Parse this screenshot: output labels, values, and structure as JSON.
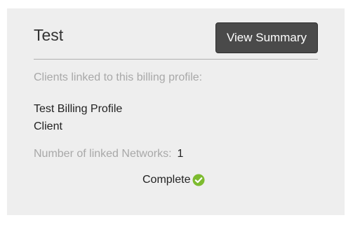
{
  "card": {
    "title": "Test",
    "view_summary_label": "View Summary",
    "clients_label": "Clients linked to this billing profile:",
    "clients": [
      "Test Billing Profile",
      "Client"
    ],
    "networks_label": "Number of linked Networks:",
    "networks_count": "1",
    "status_text": "Complete",
    "status_icon": "check-circle-icon",
    "status_color": "#7dbb2f"
  }
}
